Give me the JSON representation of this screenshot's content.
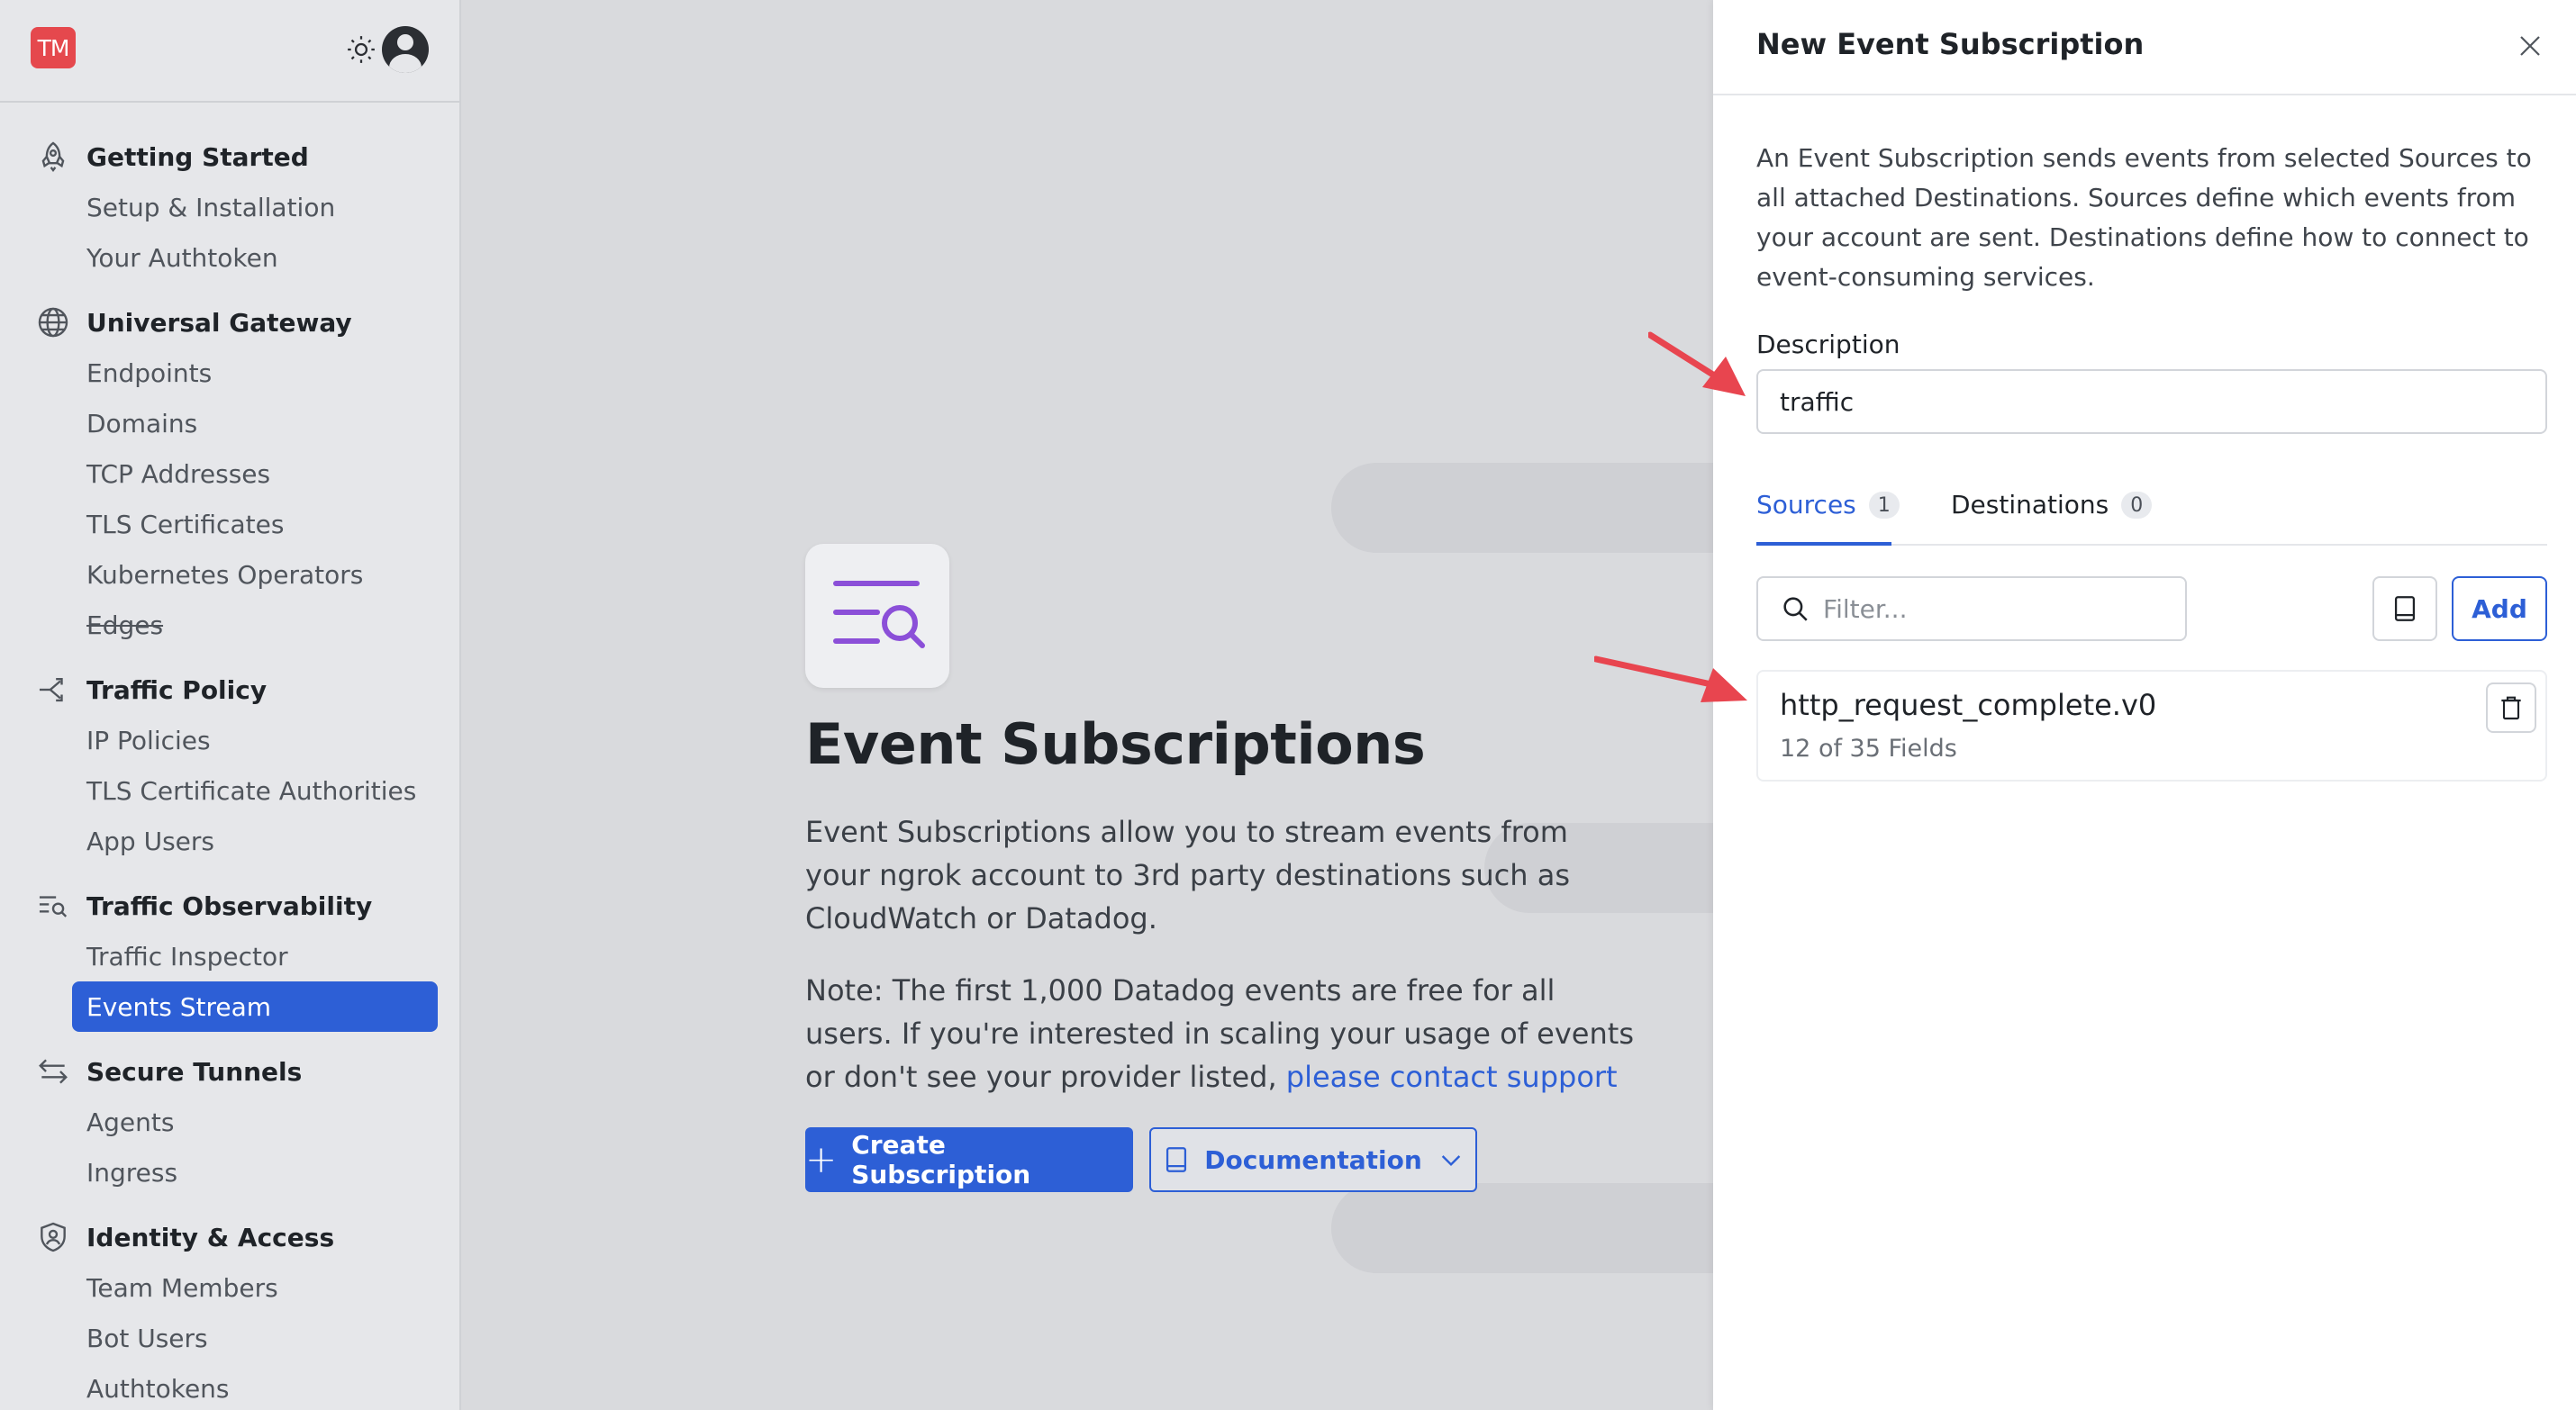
{
  "app": {
    "logo_text": "TM",
    "brand_color": "#e5484d",
    "accent_color": "#2d5fd6"
  },
  "sidebar": {
    "sections": [
      {
        "title": "Getting Started",
        "icon": "rocket-icon",
        "items": [
          {
            "label": "Setup & Installation"
          },
          {
            "label": "Your Authtoken"
          }
        ]
      },
      {
        "title": "Universal Gateway",
        "icon": "globe-icon",
        "items": [
          {
            "label": "Endpoints"
          },
          {
            "label": "Domains"
          },
          {
            "label": "TCP Addresses"
          },
          {
            "label": "TLS Certificates"
          },
          {
            "label": "Kubernetes Operators"
          },
          {
            "label": "Edges",
            "strikethrough": true
          }
        ]
      },
      {
        "title": "Traffic Policy",
        "icon": "policy-branch-icon",
        "items": [
          {
            "label": "IP Policies"
          },
          {
            "label": "TLS Certificate Authorities"
          },
          {
            "label": "App Users"
          }
        ]
      },
      {
        "title": "Traffic Observability",
        "icon": "list-search-icon",
        "items": [
          {
            "label": "Traffic Inspector"
          },
          {
            "label": "Events Stream",
            "active": true
          }
        ]
      },
      {
        "title": "Secure Tunnels",
        "icon": "arrows-left-right-icon",
        "items": [
          {
            "label": "Agents"
          },
          {
            "label": "Ingress"
          }
        ]
      },
      {
        "title": "Identity & Access",
        "icon": "shield-user-icon",
        "items": [
          {
            "label": "Team Members"
          },
          {
            "label": "Bot Users"
          },
          {
            "label": "Authtokens"
          }
        ]
      }
    ]
  },
  "main": {
    "title": "Event Subscriptions",
    "intro": "Event Subscriptions allow you to stream events from your ngrok account to 3rd party destinations such as CloudWatch or Datadog.",
    "note_prefix": "Note: The first 1,000 Datadog events are free for all users. If you're interested in scaling your usage of events or don't see your provider listed, ",
    "note_link": "please contact support",
    "create_button": "Create Subscription",
    "docs_button": "Documentation"
  },
  "drawer": {
    "title": "New Event Subscription",
    "description": "An Event Subscription sends events from selected Sources to all attached Destinations. Sources define which events from your account are sent. Destinations define how to connect to event-consuming services.",
    "description_label": "Description",
    "description_value": "traffic",
    "tabs": [
      {
        "label": "Sources",
        "count": "1",
        "active": true
      },
      {
        "label": "Destinations",
        "count": "0",
        "active": false
      }
    ],
    "filter_placeholder": "Filter...",
    "add_button": "Add",
    "sources": [
      {
        "name": "http_request_complete.v0",
        "fields": "12 of 35 Fields"
      }
    ]
  }
}
